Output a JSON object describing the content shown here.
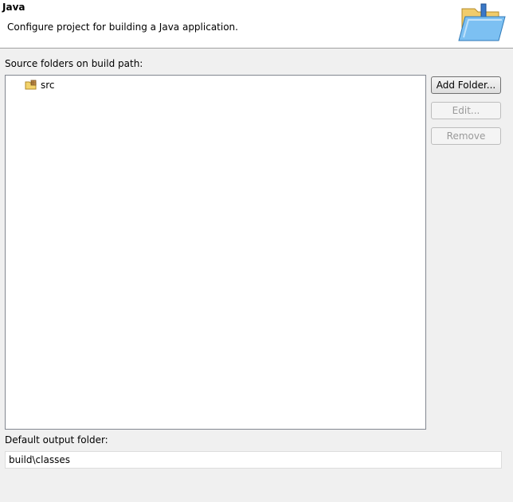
{
  "banner": {
    "title": "Java",
    "description": "Configure project for building a Java application.",
    "icon": "java-folder-wizard-icon"
  },
  "source_folders": {
    "label": "Source folders on build path:",
    "items": [
      {
        "label": "src",
        "icon": "package-folder-icon"
      }
    ]
  },
  "buttons": {
    "add_folder": "Add Folder...",
    "edit": "Edit...",
    "remove": "Remove"
  },
  "output": {
    "label": "Default output folder:",
    "value": "build\\classes"
  },
  "colors": {
    "background": "#f0f0f0",
    "banner_bg": "#ffffff",
    "folder_yellow": "#f3d36b",
    "folder_blue": "#5aa7e6"
  }
}
